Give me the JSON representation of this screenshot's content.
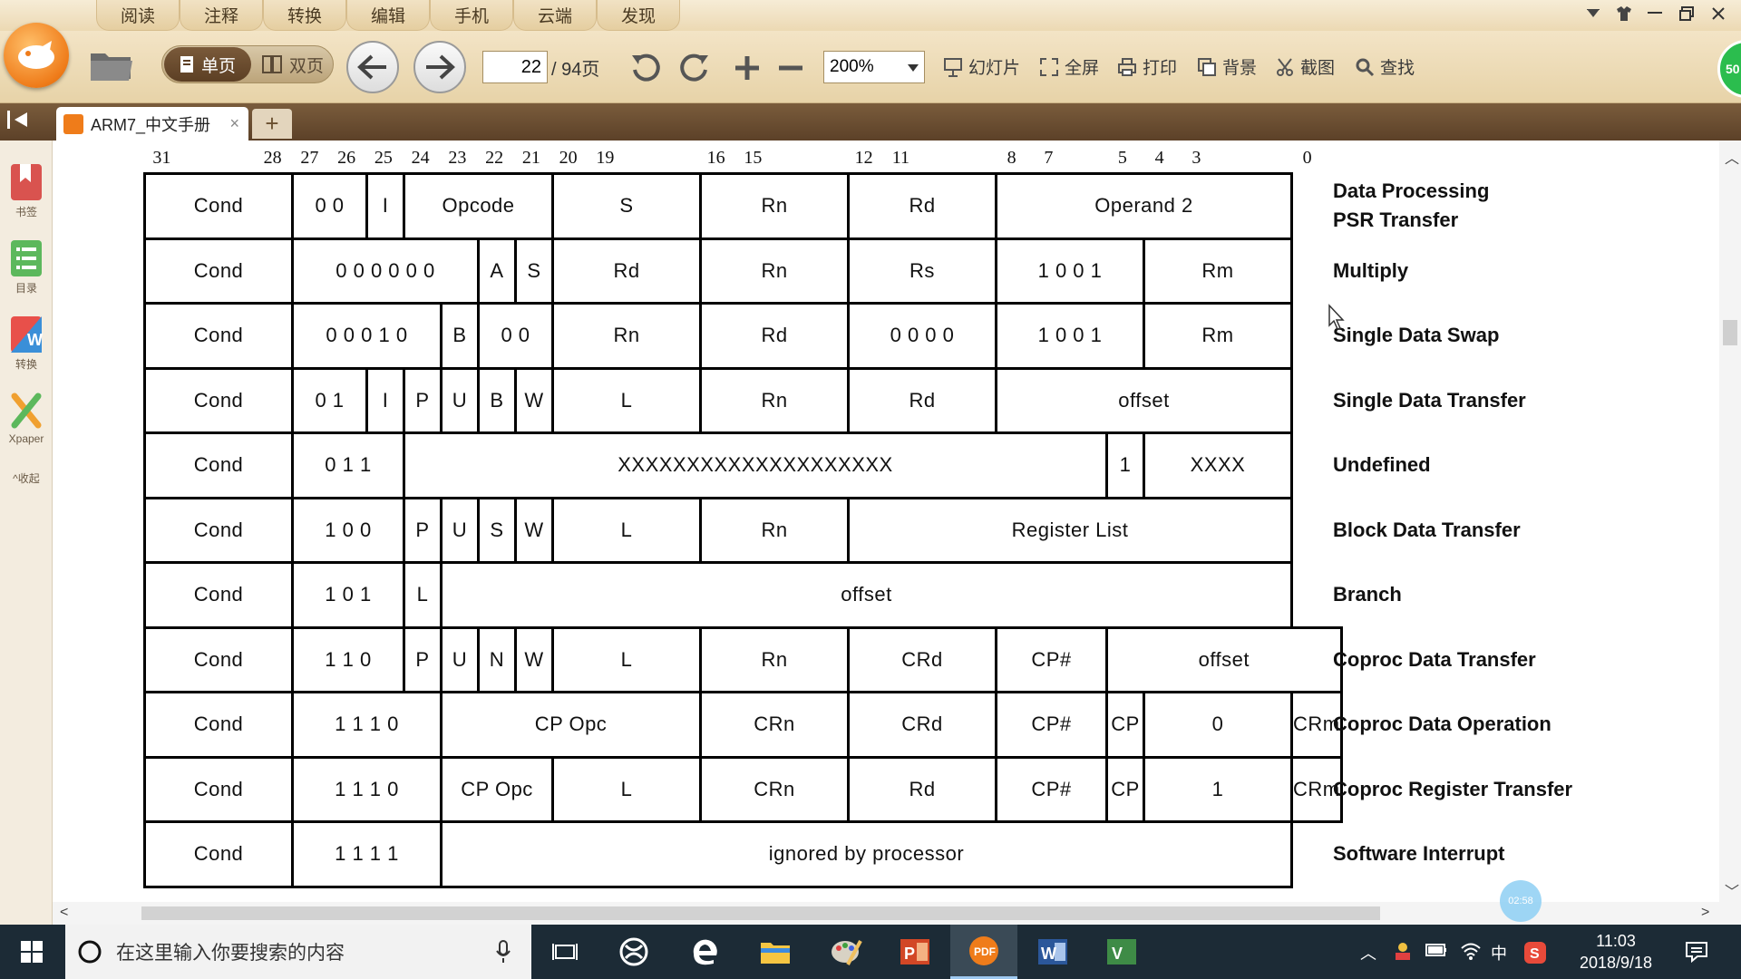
{
  "menu": {
    "tabs": [
      "阅读",
      "注释",
      "转换",
      "编辑",
      "手机",
      "云端",
      "发现"
    ]
  },
  "window_controls": [
    "▼",
    "👕",
    "—",
    "❐",
    "✕"
  ],
  "toolbar": {
    "single_page_label": "单页",
    "double_page_label": "双页",
    "page_current": "22",
    "page_total": "/ 94页",
    "zoom_value": "200%",
    "slideshow_label": "幻灯片",
    "fullscreen_label": "全屏",
    "print_label": "打印",
    "background_label": "背景",
    "screenshot_label": "截图",
    "find_label": "查找",
    "avatar_badge": "50"
  },
  "tabs": {
    "document_title": "ARM7_中文手册",
    "close_glyph": "×",
    "new_tab_glyph": "+"
  },
  "sidebar": {
    "items": [
      {
        "label": "书签",
        "icon": "bookmark-icon",
        "color": "#d9534f"
      },
      {
        "label": "目录",
        "icon": "toc-icon",
        "color": "#5cb85c"
      },
      {
        "label": "转换",
        "icon": "convert-icon",
        "color": "#3a8fd8"
      },
      {
        "label": "Xpaper",
        "icon": "xpaper-icon",
        "color": "#f0a030"
      }
    ],
    "collapse_label": "^收起"
  },
  "document": {
    "bit_numbers": [
      "31",
      "28",
      "27",
      "26",
      "25",
      "24",
      "23",
      "22",
      "21",
      "20",
      "19",
      "16",
      "15",
      "12",
      "11",
      "8",
      "7",
      "5",
      "4",
      "3",
      "0"
    ],
    "rows": [
      {
        "name": "Data Processing",
        "name2": "PSR Transfer",
        "cells": [
          "Cond",
          "0  0",
          "I",
          "Opcode",
          "S",
          "Rn",
          "Rd",
          "Operand 2"
        ]
      },
      {
        "name": "Multiply",
        "cells": [
          "Cond",
          "0  0  0  0  0  0",
          "A",
          "S",
          "Rd",
          "Rn",
          "Rs",
          "1  0  0  1",
          "Rm"
        ]
      },
      {
        "name": "Single Data Swap",
        "cells": [
          "Cond",
          "0  0  0  1  0",
          "B",
          "0 0",
          "Rn",
          "Rd",
          "0  0  0  0",
          "1  0  0  1",
          "Rm"
        ]
      },
      {
        "name": "Single Data Transfer",
        "cells": [
          "Cond",
          "0  1",
          "I",
          "P",
          "U",
          "B",
          "W",
          "L",
          "Rn",
          "Rd",
          "offset"
        ]
      },
      {
        "name": "Undefined",
        "cells": [
          "Cond",
          "0  1  1",
          "XXXXXXXXXXXXXXXXXXXX",
          "1",
          "XXXX"
        ]
      },
      {
        "name": "Block Data Transfer",
        "cells": [
          "Cond",
          "1  0  0",
          "P",
          "U",
          "S",
          "W",
          "L",
          "Rn",
          "Register List"
        ]
      },
      {
        "name": "Branch",
        "cells": [
          "Cond",
          "1  0  1",
          "L",
          "offset"
        ]
      },
      {
        "name": "Coproc Data Transfer",
        "cells": [
          "Cond",
          "1  1  0",
          "P",
          "U",
          "N",
          "W",
          "L",
          "Rn",
          "CRd",
          "CP#",
          "offset"
        ]
      },
      {
        "name": "Coproc Data Operation",
        "cells": [
          "Cond",
          "1  1  1  0",
          "CP Opc",
          "CRn",
          "CRd",
          "CP#",
          "CP",
          "0",
          "CRm"
        ]
      },
      {
        "name": "Coproc Register Transfer",
        "cells": [
          "Cond",
          "1  1  1  0",
          "CP Opc",
          "L",
          "CRn",
          "Rd",
          "CP#",
          "CP",
          "1",
          "CRm"
        ]
      },
      {
        "name": "Software Interrupt",
        "cells": [
          "Cond",
          "1  1  1  1",
          "ignored by processor"
        ]
      }
    ],
    "timer_badge": "02:58"
  },
  "taskbar": {
    "search_placeholder": "在这里输入你要搜索的内容",
    "apps": [
      "task-view",
      "snipping-app",
      "edge-browser",
      "file-explorer",
      "paint-app",
      "powerpoint-app",
      "foxit-pdf-app",
      "word-app",
      "visio-app"
    ],
    "tray_ime": "中",
    "clock_time": "11:03",
    "clock_date": "2018/9/18"
  }
}
